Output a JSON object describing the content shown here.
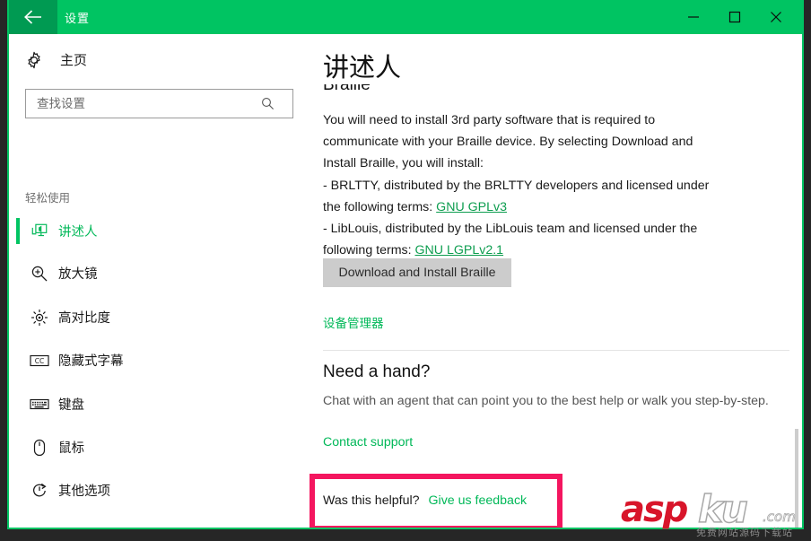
{
  "window": {
    "app_title": "设置",
    "back_icon": "back-arrow-icon",
    "minimize_label": "—",
    "maximize_label": "□",
    "close_label": "✕",
    "accent_green": "#00c462",
    "back_button_green": "#009a52"
  },
  "sidebar": {
    "home_label": "主页",
    "home_icon": "gear-icon",
    "search": {
      "placeholder": "查找设置",
      "value": "",
      "icon": "search-icon"
    },
    "group_label": "轻松使用",
    "items": [
      {
        "label": "讲述人",
        "icon": "narrator-icon",
        "active": true
      },
      {
        "label": "放大镜",
        "icon": "magnifier-icon",
        "active": false
      },
      {
        "label": "高对比度",
        "icon": "brightness-icon",
        "active": false
      },
      {
        "label": "隐藏式字幕",
        "icon": "closed-caption-icon",
        "active": false
      },
      {
        "label": "键盘",
        "icon": "keyboard-icon",
        "active": false
      },
      {
        "label": "鼠标",
        "icon": "mouse-icon",
        "active": false
      },
      {
        "label": "其他选项",
        "icon": "other-options-icon",
        "active": false
      }
    ]
  },
  "main": {
    "page_title": "讲述人",
    "section_heading": "Braille",
    "intro_paragraph": "You will need to install 3rd party software that is required to communicate with your Braille device. By selecting Download and Install Braille, you will install:",
    "brltty_text_before": "- BRLTTY, distributed by the BRLTTY developers and licensed under the following terms: ",
    "brltty_link": "GNU GPLv3",
    "liblouis_text_before": "- LibLouis, distributed by the LibLouis team and licensed under the following terms: ",
    "liblouis_link": "GNU LGPLv2.1",
    "install_button_label": "Download and Install Braille",
    "device_manager_link": "设备管理器",
    "need_hand_title": "Need a hand?",
    "need_hand_desc": "Chat with an agent that can point you to the best help or walk you step-by-step.",
    "contact_support_link": "Contact support",
    "feedback_question": "Was this helpful?",
    "feedback_link": "Give us feedback",
    "link_color": "#0d9d4f",
    "button_bg": "#cccccc"
  },
  "annotation": {
    "highlight_color": "#f4165f"
  },
  "watermark": {
    "text_primary": "asp",
    "text_secondary": "ku",
    "text_tld": ".com",
    "subtitle": "免费网站源码下载站",
    "primary_color": "#d8152a"
  }
}
